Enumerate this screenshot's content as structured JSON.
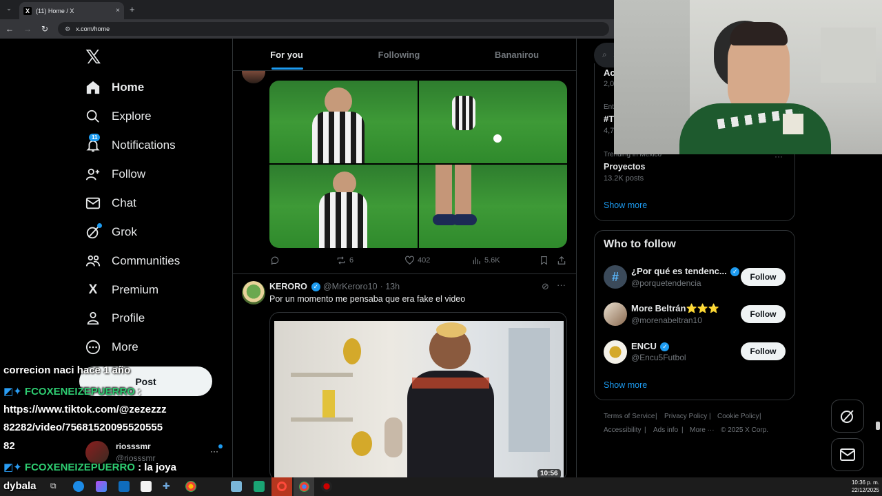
{
  "browser": {
    "tab_title": "(11) Home / X",
    "tab_close": "×",
    "new_tab": "+",
    "url": "x.com/home"
  },
  "sidebar": {
    "logo": "𝕏",
    "items": [
      {
        "label": "Home",
        "icon": "home-icon"
      },
      {
        "label": "Explore",
        "icon": "search-icon"
      },
      {
        "label": "Notifications",
        "icon": "bell-icon",
        "badge": "11"
      },
      {
        "label": "Follow",
        "icon": "person-add-icon"
      },
      {
        "label": "Chat",
        "icon": "mail-icon"
      },
      {
        "label": "Grok",
        "icon": "grok-icon"
      },
      {
        "label": "Communities",
        "icon": "people-icon"
      },
      {
        "label": "Premium",
        "icon": "x-logo-icon"
      },
      {
        "label": "Profile",
        "icon": "person-icon"
      },
      {
        "label": "More",
        "icon": "more-circle-icon"
      }
    ],
    "post_button": "Post",
    "account": {
      "name": "riosssmr",
      "handle": "@riosssmr",
      "menu": "···"
    }
  },
  "feed": {
    "tabs": [
      "For you",
      "Following",
      "Bananirou"
    ],
    "active_tab": "For you",
    "post1": {
      "replies": "",
      "reposts": "6",
      "likes": "402",
      "views": "5.6K"
    },
    "post2": {
      "name": "KERORO",
      "handle": "@MrKeroro10",
      "time": "· 13h",
      "text": "Por un momento me pensaba que era fake el video",
      "video_duration": "10:56"
    }
  },
  "right": {
    "search_placeholder": "S",
    "trends_partial": [
      {
        "label": "Ac",
        "count": "2,0"
      },
      {
        "label": "Ent",
        "name": "#T",
        "count": "4,7"
      }
    ],
    "trend": {
      "context": "Trending in Mexico",
      "name": "Proyectos",
      "count": "13.2K posts"
    },
    "show_more_1": "Show more",
    "who_to_follow_title": "Who to follow",
    "accounts": [
      {
        "name": "¿Por qué es tendenc...",
        "handle": "@porquetendencia",
        "button": "Follow"
      },
      {
        "name": "More Beltrán⭐⭐⭐",
        "handle": "@morenabeltran10",
        "button": "Follow"
      },
      {
        "name": "ENCU",
        "handle": "@Encu5Futbol",
        "button": "Follow"
      }
    ],
    "show_more_2": "Show more",
    "footer": [
      "Terms of Service",
      "|",
      "Privacy Policy",
      "|",
      "Cookie Policy",
      "|",
      "Accessibility",
      "|",
      "Ads info",
      "|",
      "More ···",
      "© 2025 X Corp."
    ]
  },
  "chat_overlay": [
    {
      "user": "",
      "text": "correcion naci hace 1 año"
    },
    {
      "user": "FCOXENEIZEPUERRO",
      "text": ":"
    },
    {
      "user": "",
      "text": "https://www.tiktok.com/@zezezzz"
    },
    {
      "user": "",
      "text": "82282/video/75681520095520555"
    },
    {
      "user": "",
      "text": "82"
    },
    {
      "user": "FCOXENEIZEPUERRO",
      "text": ": la joya"
    },
    {
      "user": "",
      "text": "dybala"
    }
  ],
  "taskbar": {
    "time": "10:36 p. m.",
    "date": "22/12/2025"
  },
  "colors": {
    "accent": "#1d9bf0",
    "background": "#000000",
    "border": "#2f3336",
    "muted_text": "#71767b"
  }
}
